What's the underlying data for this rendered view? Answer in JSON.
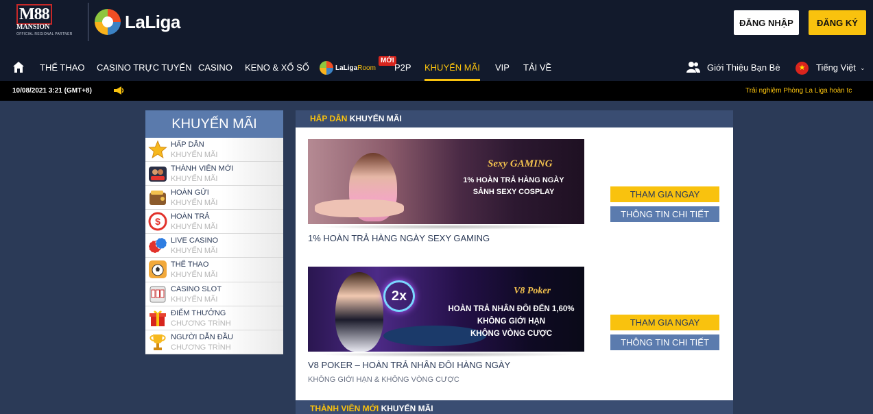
{
  "header": {
    "brand": {
      "m88_mark": "M88",
      "m88_sub": "MANSION",
      "partner": "OFFICIAL REGIONAL PARTNER",
      "laliga": "LaLiga"
    },
    "login_label": "ĐĂNG NHẬP",
    "register_label": "ĐĂNG KÝ"
  },
  "nav": {
    "items": [
      "THỂ THAO",
      "CASINO TRỰC TUYẾN",
      "CASINO",
      "KENO & XỔ SỐ",
      "P2P",
      "KHUYẾN MÃI",
      "VIP",
      "TẢI VỀ"
    ],
    "laliga_room": {
      "brand": "LaLiga",
      "room": "Room"
    },
    "new_badge": "MỚI",
    "active_index": 5,
    "refer_friends": "Giới Thiệu Bạn Bè",
    "language": "Tiếng Việt"
  },
  "ticker": {
    "datetime": "10/08/2021 3:21 (GMT+8)",
    "message": "Trải nghiệm Phòng La Liga hoàn tc"
  },
  "sidebar": {
    "title": "KHUYẾN MÃI",
    "items": [
      {
        "title": "HẤP DẪN",
        "subtitle": "KHUYẾN MÃI",
        "icon": "star-icon"
      },
      {
        "title": "THÀNH VIÊN MỚI",
        "subtitle": "KHUYẾN MÃI",
        "icon": "new-member-icon"
      },
      {
        "title": "HOÀN GỬI",
        "subtitle": "KHUYẾN MÃI",
        "icon": "wallet-icon"
      },
      {
        "title": "HOÀN TRẢ",
        "subtitle": "KHUYẾN MÃI",
        "icon": "dollar-refund-icon"
      },
      {
        "title": "LIVE CASINO",
        "subtitle": "KHUYẾN MÃI",
        "icon": "chips-icon"
      },
      {
        "title": "THỂ THAO",
        "subtitle": "KHUYẾN MÃI",
        "icon": "sports-icon"
      },
      {
        "title": "CASINO SLOT",
        "subtitle": "KHUYẾN MÃI",
        "icon": "slot-icon"
      },
      {
        "title": "ĐIỂM THƯỞNG",
        "subtitle": "CHƯƠNG TRÌNH",
        "icon": "gift-icon"
      },
      {
        "title": "NGƯỜI DẪN ĐẦU",
        "subtitle": "CHƯƠNG TRÌNH",
        "icon": "trophy-icon"
      }
    ]
  },
  "main": {
    "section1": {
      "highlight": "HẤP DẪN",
      "rest": "KHUYẾN MÃI"
    },
    "section2": {
      "highlight": "THÀNH VIÊN MỚI",
      "rest": "KHUYẾN MÃI"
    },
    "promos": [
      {
        "banner_logo": "Sexy GAMING",
        "banner_line1": "1% HOÀN TRẢ HÀNG NGÀY",
        "banner_line2": "SẢNH SEXY COSPLAY",
        "title": "1% HOÀN TRẢ HÀNG NGÀY SEXY GAMING",
        "subtitle": "",
        "join_label": "THAM GIA NGAY",
        "info_label": "THÔNG TIN CHI TIẾT"
      },
      {
        "banner_logo": "V8 Poker",
        "banner_badge": "2x",
        "banner_line1": "HOÀN TRẢ NHÂN ĐÔI ĐẾN 1,60%",
        "banner_line2": "KHÔNG GIỚI HẠN",
        "banner_line3": "KHÔNG VÒNG CƯỢC",
        "title": "V8 POKER – HOÀN TRẢ NHÂN ĐÔI HÀNG NGÀY",
        "subtitle": "KHÔNG GIỚI HẠN & KHÔNG VÒNG CƯỢC",
        "join_label": "THAM GIA NGAY",
        "info_label": "THÔNG TIN CHI TIẾT"
      }
    ]
  },
  "colors": {
    "accent": "#f9c20e",
    "header_bg": "#121a2c",
    "page_bg": "#2b3a57",
    "side_head": "#5a7aac",
    "info_btn": "#5b7bae"
  }
}
